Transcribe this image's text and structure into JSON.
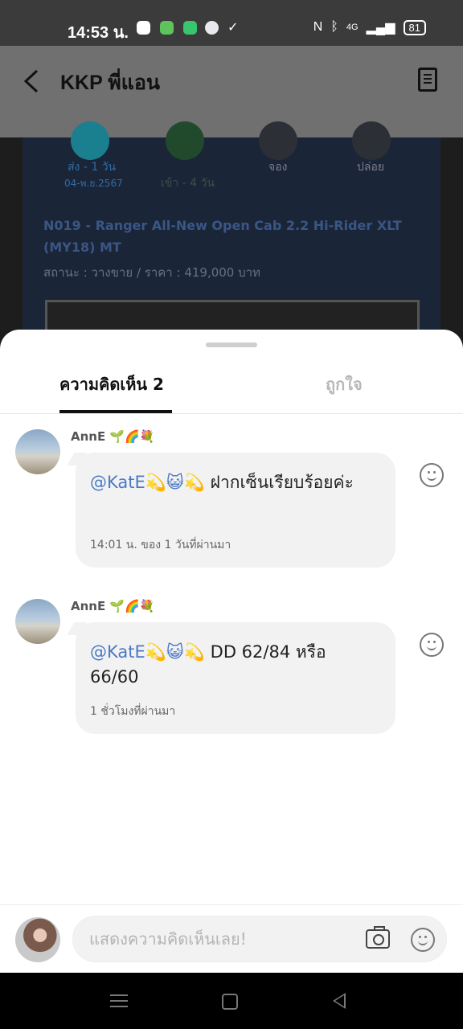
{
  "status_bar": {
    "time": "14:53 น.",
    "network": "4G",
    "battery": "81"
  },
  "header": {
    "title": "KKP พี่แอน"
  },
  "background_card": {
    "steps": [
      {
        "label": "ส่ง - 1 วัน",
        "date": "04-พ.ย.2567"
      },
      {
        "label": "เข้า - 4 วัน"
      },
      {
        "label": "จอง"
      },
      {
        "label": "ปล่อย"
      }
    ],
    "car_title": "N019 - Ranger All-New Open Cab 2.2 Hi-Rider XLT (MY18) MT",
    "car_status": "สถานะ : วางขาย / ราคา : 419,000 บาท"
  },
  "tabs": {
    "comments": "ความคิดเห็น 2",
    "likes": "ถูกใจ"
  },
  "comments": [
    {
      "name": "AnnE 🌱🌈💐",
      "mention": "@KatE💫😺💫",
      "text": " ฝากเซ็นเรียบร้อยค่ะ",
      "time": "14:01 น. ของ 1 วันที่ผ่านมา"
    },
    {
      "name": "AnnE 🌱🌈💐",
      "mention": "@KatE💫😺💫",
      "text": " DD 62/84 หรือ 66/60",
      "time": "1 ชั่วโมงที่ผ่านมา"
    }
  ],
  "input": {
    "placeholder": "แสดงความคิดเห็นเลย!"
  },
  "icons": [
    "back-icon",
    "document-icon",
    "smiley-icon",
    "camera-icon",
    "menu-icon",
    "home-icon",
    "nav-back-icon"
  ]
}
